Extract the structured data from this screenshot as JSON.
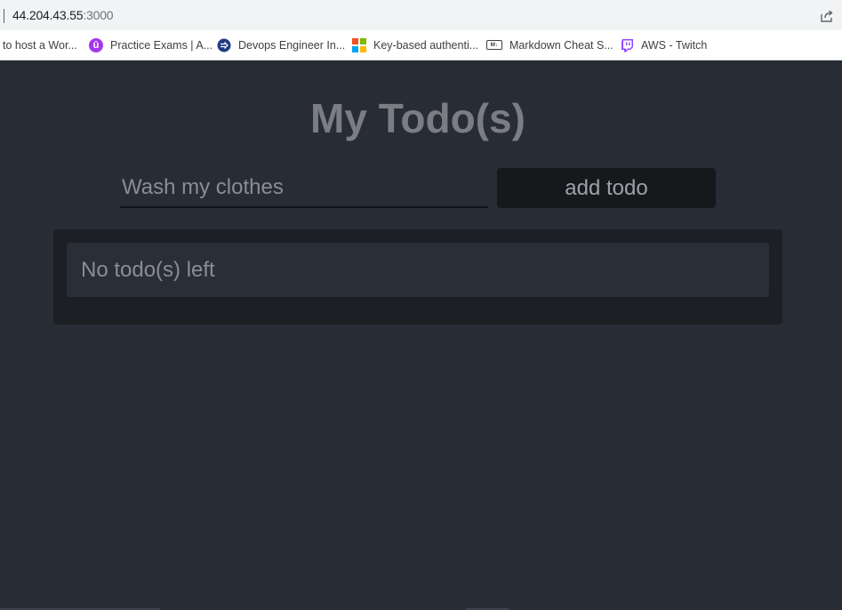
{
  "browser": {
    "url_host": "44.204.43.55",
    "url_port": ":3000",
    "bookmarks": [
      {
        "label": "to host a Wor...",
        "icon": "none"
      },
      {
        "label": "Practice Exams | A...",
        "icon": "udemy-icon"
      },
      {
        "label": "Devops Engineer In...",
        "icon": "arrow-circle-icon"
      },
      {
        "label": "Key-based authenti...",
        "icon": "microsoft-icon"
      },
      {
        "label": "Markdown Cheat S...",
        "icon": "markdown-icon"
      },
      {
        "label": "AWS - Twitch",
        "icon": "twitch-icon"
      }
    ],
    "udemy_glyph": "û",
    "markdown_glyph": "M↓"
  },
  "app": {
    "title": "My Todo(s)",
    "input_placeholder": "Wash my clothes",
    "add_button_label": "add todo",
    "empty_message": "No todo(s) left"
  },
  "colors": {
    "page_background": "#282c34",
    "title": "#7a7d84",
    "panel": "#1c1f24",
    "button": "#16181c",
    "udemy": "#a435f0",
    "devops": "#1f3b82",
    "twitch": "#9146ff"
  }
}
